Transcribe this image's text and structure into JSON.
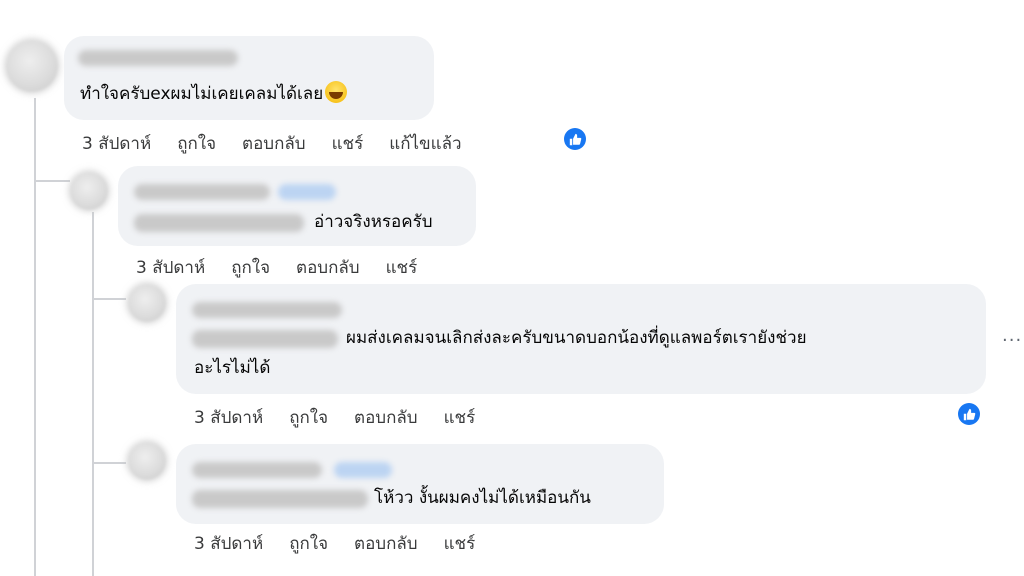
{
  "comments": [
    {
      "text": "ทำใจครับexผมไม่เคยเคลมได้เลย",
      "emoji": "grinning-sweat-emoji",
      "actions": [
        "3 สัปดาห์",
        "ถูกใจ",
        "ตอบกลับ",
        "แชร์",
        "แก้ไขแล้ว"
      ]
    },
    {
      "text": "อ่าวจริงหรอครับ",
      "actions": [
        "3 สัปดาห์",
        "ถูกใจ",
        "ตอบกลับ",
        "แชร์"
      ]
    },
    {
      "text_line1": "ผมส่งเคลมจนเลิกส่งละครับขนาดบอกน้องที่ดูแลพอร์ตเรายังช่วย",
      "text_line2": "อะไรไม่ได้",
      "actions": [
        "3 สัปดาห์",
        "ถูกใจ",
        "ตอบกลับ",
        "แชร์"
      ]
    },
    {
      "text": "โห้วว งั้นผมคงไม่ได้เหมือนกัน",
      "actions": [
        "3 สัปดาห์",
        "ถูกใจ",
        "ตอบกลับ",
        "แชร์"
      ]
    }
  ],
  "more_menu": "···",
  "colors": {
    "like_blue": "#1877f2",
    "bubble": "#f0f2f5",
    "meta_text": "#3a3b3c"
  }
}
